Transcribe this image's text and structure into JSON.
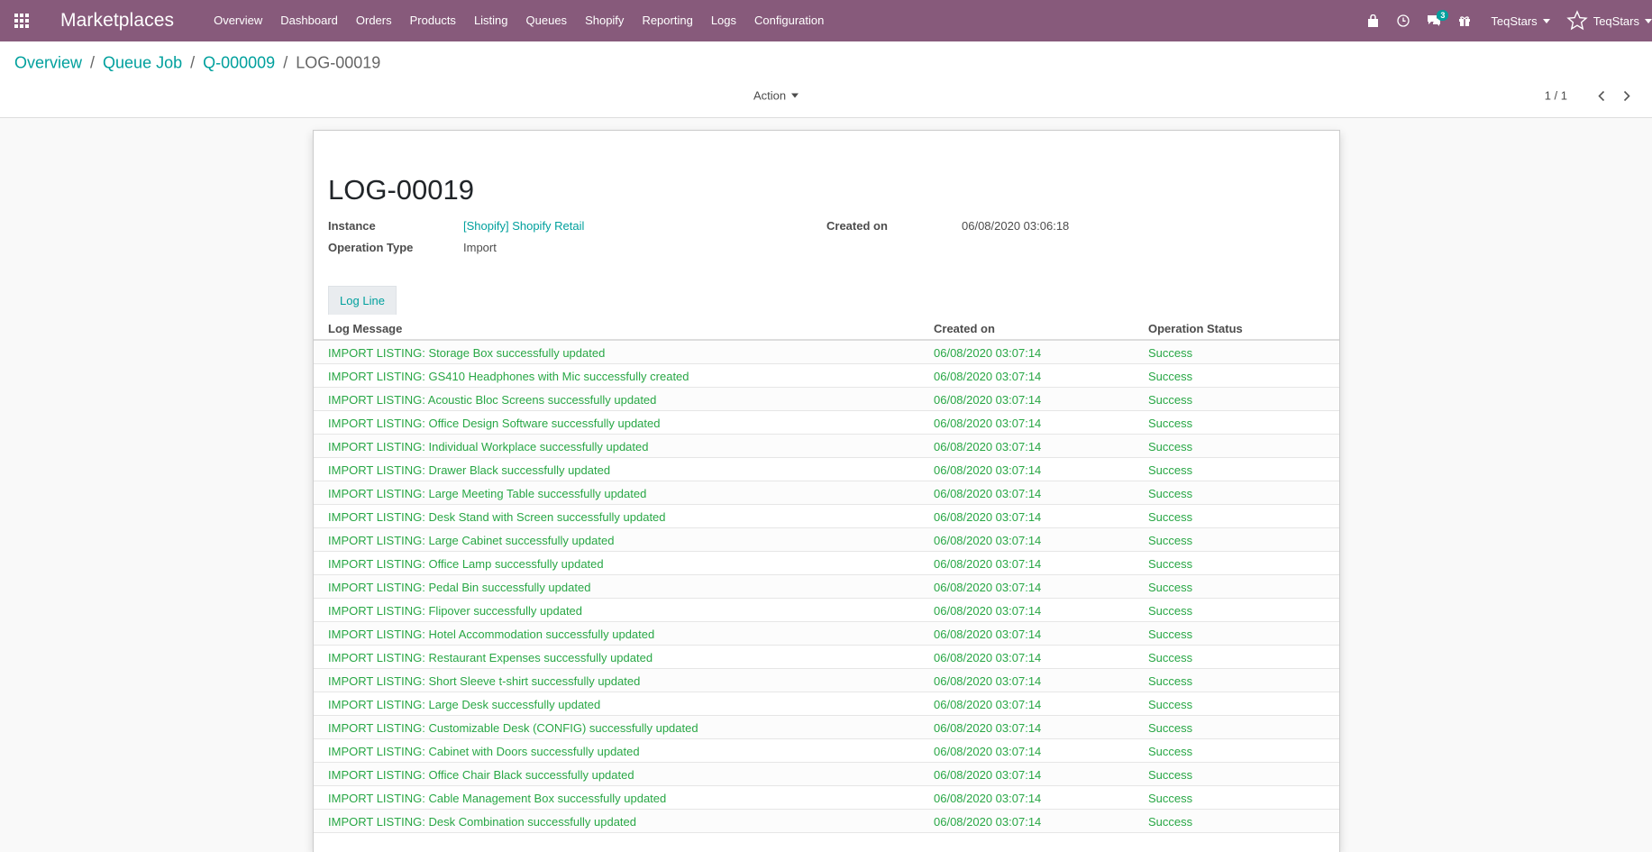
{
  "navbar": {
    "brand": "Marketplaces",
    "menu": [
      "Overview",
      "Dashboard",
      "Orders",
      "Products",
      "Listing",
      "Queues",
      "Shopify",
      "Reporting",
      "Logs",
      "Configuration"
    ],
    "messages_count": "3",
    "company": "TeqStars",
    "user": "TeqStars"
  },
  "breadcrumb": {
    "items": [
      "Overview",
      "Queue Job",
      "Q-000009"
    ],
    "current": "LOG-00019"
  },
  "control": {
    "action_label": "Action",
    "pager_value": "1 / 1"
  },
  "record": {
    "title": "LOG-00019",
    "instance_label": "Instance",
    "instance_value": "[Shopify] Shopify Retail",
    "operation_type_label": "Operation Type",
    "operation_type_value": "Import",
    "created_on_label": "Created on",
    "created_on_value": "06/08/2020 03:06:18"
  },
  "tab_label": "Log Line",
  "table": {
    "headers": [
      "Log Message",
      "Created on",
      "Operation Status"
    ],
    "rows": [
      [
        "IMPORT LISTING: Storage Box successfully updated",
        "06/08/2020 03:07:14",
        "Success"
      ],
      [
        "IMPORT LISTING: GS410 Headphones with Mic successfully created",
        "06/08/2020 03:07:14",
        "Success"
      ],
      [
        "IMPORT LISTING: Acoustic Bloc Screens successfully updated",
        "06/08/2020 03:07:14",
        "Success"
      ],
      [
        "IMPORT LISTING: Office Design Software successfully updated",
        "06/08/2020 03:07:14",
        "Success"
      ],
      [
        "IMPORT LISTING: Individual Workplace successfully updated",
        "06/08/2020 03:07:14",
        "Success"
      ],
      [
        "IMPORT LISTING: Drawer Black successfully updated",
        "06/08/2020 03:07:14",
        "Success"
      ],
      [
        "IMPORT LISTING: Large Meeting Table successfully updated",
        "06/08/2020 03:07:14",
        "Success"
      ],
      [
        "IMPORT LISTING: Desk Stand with Screen successfully updated",
        "06/08/2020 03:07:14",
        "Success"
      ],
      [
        "IMPORT LISTING: Large Cabinet successfully updated",
        "06/08/2020 03:07:14",
        "Success"
      ],
      [
        "IMPORT LISTING: Office Lamp successfully updated",
        "06/08/2020 03:07:14",
        "Success"
      ],
      [
        "IMPORT LISTING: Pedal Bin successfully updated",
        "06/08/2020 03:07:14",
        "Success"
      ],
      [
        "IMPORT LISTING: Flipover successfully updated",
        "06/08/2020 03:07:14",
        "Success"
      ],
      [
        "IMPORT LISTING: Hotel Accommodation successfully updated",
        "06/08/2020 03:07:14",
        "Success"
      ],
      [
        "IMPORT LISTING: Restaurant Expenses successfully updated",
        "06/08/2020 03:07:14",
        "Success"
      ],
      [
        "IMPORT LISTING: Short Sleeve t-shirt successfully updated",
        "06/08/2020 03:07:14",
        "Success"
      ],
      [
        "IMPORT LISTING: Large Desk successfully updated",
        "06/08/2020 03:07:14",
        "Success"
      ],
      [
        "IMPORT LISTING: Customizable Desk (CONFIG) successfully updated",
        "06/08/2020 03:07:14",
        "Success"
      ],
      [
        "IMPORT LISTING: Cabinet with Doors successfully updated",
        "06/08/2020 03:07:14",
        "Success"
      ],
      [
        "IMPORT LISTING: Office Chair Black successfully updated",
        "06/08/2020 03:07:14",
        "Success"
      ],
      [
        "IMPORT LISTING: Cable Management Box successfully updated",
        "06/08/2020 03:07:14",
        "Success"
      ],
      [
        "IMPORT LISTING: Desk Combination successfully updated",
        "06/08/2020 03:07:14",
        "Success"
      ]
    ]
  },
  "colors": {
    "navbar": "#875a7b",
    "link": "#00a09d",
    "success": "#28a745"
  },
  "icons": [
    "apps-grid-icon",
    "shopping-bag-icon",
    "clock-icon",
    "chat-icon",
    "gift-icon",
    "star-icon",
    "chevron-left-icon",
    "chevron-right-icon"
  ]
}
